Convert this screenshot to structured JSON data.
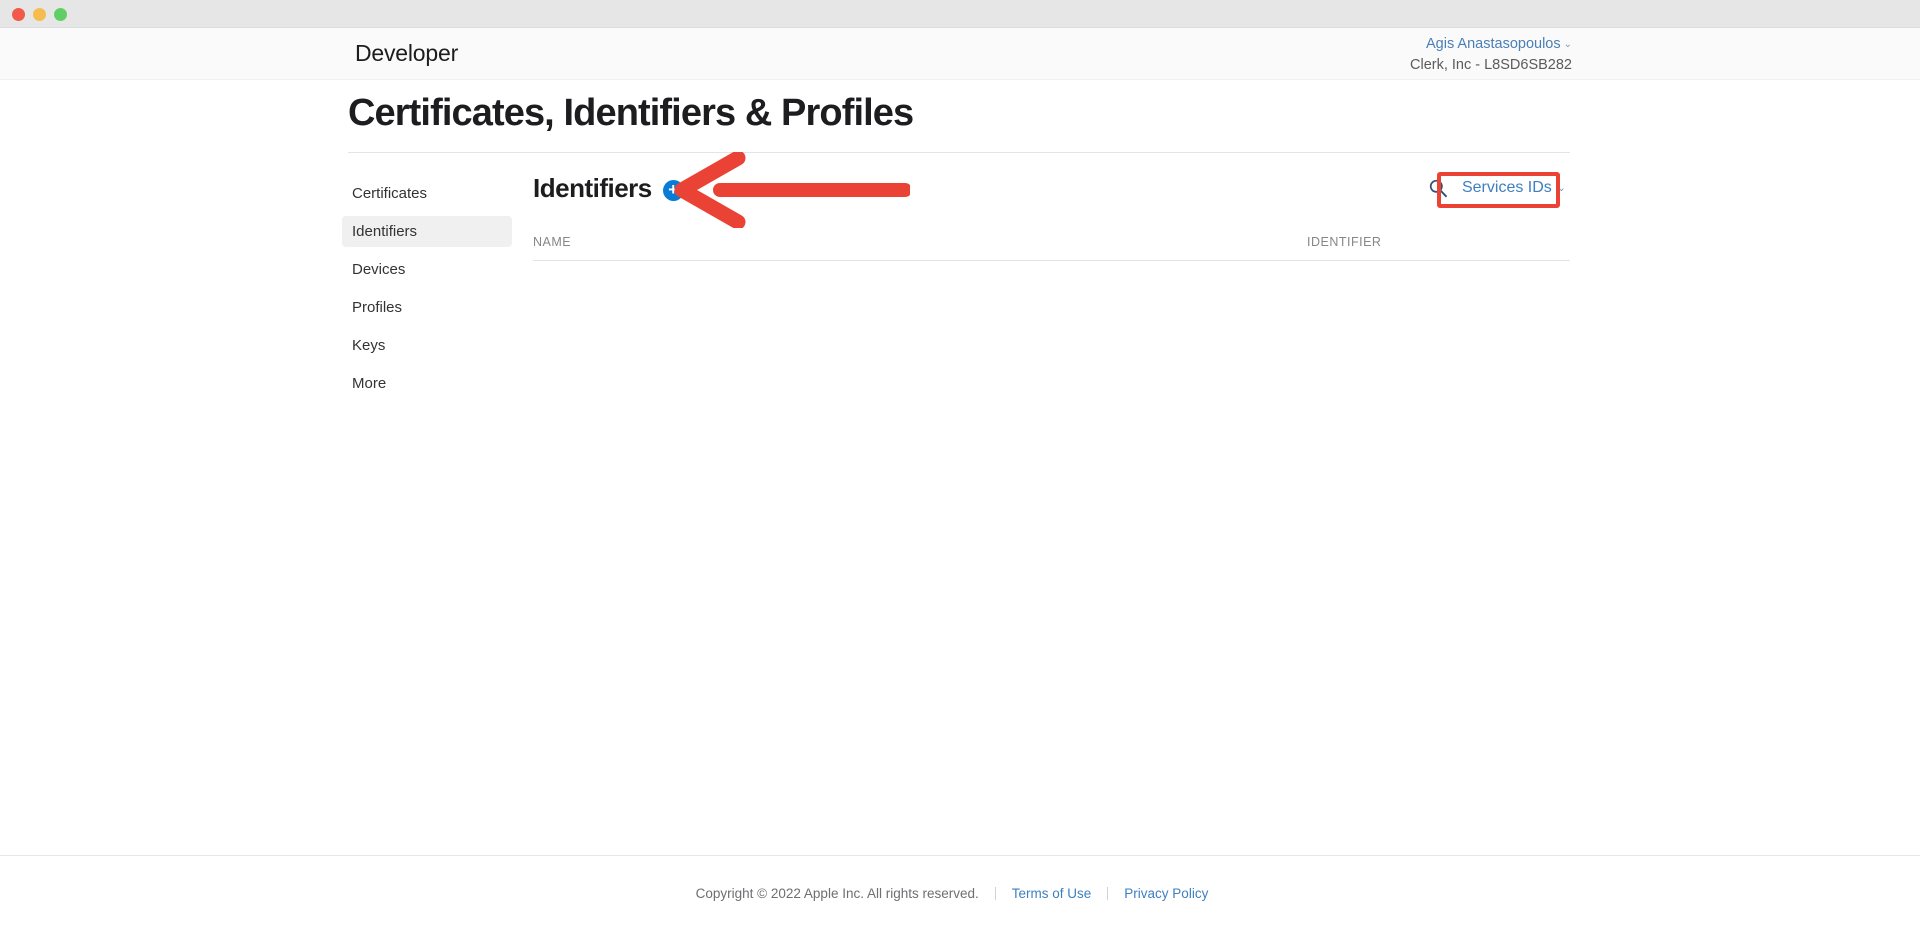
{
  "window": {
    "traffic_lights": [
      "close-button",
      "minimize-button",
      "maximize-button"
    ],
    "colors": {
      "close": "#f2594b",
      "minimize": "#f5bd4f",
      "maximize": "#5fcf65",
      "accent_blue": "#0a7bd4",
      "link_blue": "#3e7fc1",
      "annotation_red": "#ea4335"
    }
  },
  "header": {
    "apple_glyph": "",
    "brand": "Developer",
    "account_name": "Agis Anastasopoulos",
    "account_chevron": "⌄",
    "team": "Clerk, Inc - L8SD6SB282"
  },
  "page": {
    "title": "Certificates, Identifiers & Profiles"
  },
  "sidebar": {
    "items": [
      {
        "label": "Certificates",
        "selected": false
      },
      {
        "label": "Identifiers",
        "selected": true
      },
      {
        "label": "Devices",
        "selected": false
      },
      {
        "label": "Profiles",
        "selected": false
      },
      {
        "label": "Keys",
        "selected": false
      },
      {
        "label": "More",
        "selected": false
      }
    ]
  },
  "main": {
    "section_title": "Identifiers",
    "add_button_label": "+",
    "search_icon": "search-icon",
    "filter": {
      "value": "Services IDs",
      "chevron": "⌄"
    },
    "table": {
      "columns": [
        "NAME",
        "IDENTIFIER"
      ],
      "rows": []
    }
  },
  "footer": {
    "copyright": "Copyright © 2022 Apple Inc. All rights reserved.",
    "links": [
      "Terms of Use",
      "Privacy Policy"
    ]
  },
  "annotations": {
    "arrow": "red-left-arrow-pointing-to-add-identifier-button",
    "rect": "red-rectangle-around-services-ids-filter"
  }
}
